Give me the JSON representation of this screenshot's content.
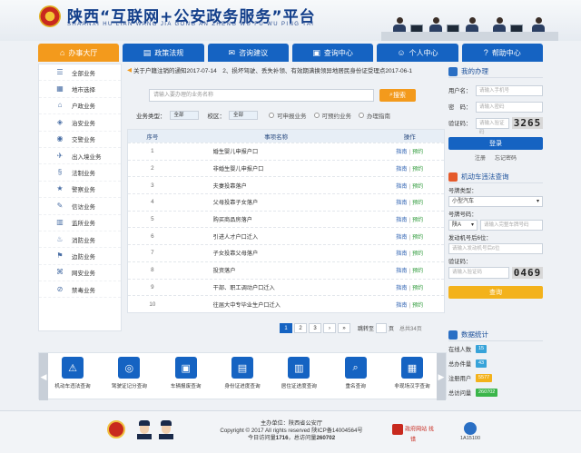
{
  "header": {
    "title": "陕西“互联网+公安政务服务”平台",
    "pinyin": "SHAANXI HU LIAN WANG JIA GONG AN ZHENG WU FU WU PING TAI"
  },
  "nav": [
    {
      "label": "办事大厅",
      "icon": "home-icon",
      "active": true
    },
    {
      "label": "政策法规",
      "icon": "book-icon",
      "active": false
    },
    {
      "label": "咨询建议",
      "icon": "chat-icon",
      "active": false
    },
    {
      "label": "查询中心",
      "icon": "search-monitor-icon",
      "active": false
    },
    {
      "label": "个人中心",
      "icon": "user-icon",
      "active": false
    },
    {
      "label": "帮助中心",
      "icon": "help-icon",
      "active": false
    }
  ],
  "sidebar": [
    {
      "label": "全部业务",
      "icon": "list-icon"
    },
    {
      "label": "地市选择",
      "icon": "city-icon"
    },
    {
      "label": "户政业务",
      "icon": "household-icon"
    },
    {
      "label": "治安业务",
      "icon": "security-icon"
    },
    {
      "label": "交警业务",
      "icon": "traffic-icon"
    },
    {
      "label": "出入境业务",
      "icon": "passport-icon"
    },
    {
      "label": "法制业务",
      "icon": "law-icon"
    },
    {
      "label": "警察业务",
      "icon": "police-icon"
    },
    {
      "label": "信访业务",
      "icon": "petition-icon"
    },
    {
      "label": "监所业务",
      "icon": "prison-icon"
    },
    {
      "label": "消防业务",
      "icon": "fire-icon"
    },
    {
      "label": "边防业务",
      "icon": "border-icon"
    },
    {
      "label": "网安业务",
      "icon": "network-icon"
    },
    {
      "label": "禁毒业务",
      "icon": "drug-icon"
    }
  ],
  "notice": "关于户籍注销的通知2017-07-14　2、损坏驾驶、丢失补领、有效期满换领异地居民身份证受理点2017-06-1",
  "search": {
    "placeholder": "请输入要办理的业务名称",
    "button": "搜索"
  },
  "filters": {
    "type_label": "业务类型：",
    "type_value": "全部",
    "area_label": "校区：",
    "area_value": "全部",
    "radios": [
      "可申报业务",
      "可预约业务",
      "办理指南"
    ]
  },
  "table": {
    "headers": [
      "序号",
      "事项名称",
      "操作"
    ],
    "rows": [
      {
        "no": "1",
        "name": "婚生婴儿申报户口",
        "guide": "指南",
        "book": "预约"
      },
      {
        "no": "2",
        "name": "非婚生婴儿申报户口",
        "guide": "指南",
        "book": "预约"
      },
      {
        "no": "3",
        "name": "夫妻投靠落户",
        "guide": "指南",
        "book": "预约"
      },
      {
        "no": "4",
        "name": "父母投靠子女落户",
        "guide": "指南",
        "book": "预约"
      },
      {
        "no": "5",
        "name": "购买商品房落户",
        "guide": "指南",
        "book": "预约"
      },
      {
        "no": "6",
        "name": "引进人才户口迁入",
        "guide": "指南",
        "book": "预约"
      },
      {
        "no": "7",
        "name": "子女投靠父母落户",
        "guide": "指南",
        "book": "预约"
      },
      {
        "no": "8",
        "name": "投资落户",
        "guide": "指南",
        "book": "预约"
      },
      {
        "no": "9",
        "name": "干部、职工调动户口迁入",
        "guide": "指南",
        "book": "预约"
      },
      {
        "no": "10",
        "name": "往届大中专毕业生户口迁入",
        "guide": "指南",
        "book": "预约"
      }
    ],
    "sep": "|"
  },
  "pager": {
    "pages": [
      "1",
      "2",
      "3"
    ],
    "next": "›",
    "last": "»",
    "jump_label": "跳转至",
    "page_unit": "页",
    "total": "总共34页"
  },
  "login": {
    "title": "我的办理",
    "user_label": "用户名：",
    "user_placeholder": "请输入手机号",
    "pwd_label": "密　码：",
    "pwd_placeholder": "请输入密码",
    "code_label": "验证码：",
    "code_placeholder": "请输入验证码",
    "code_value": "3265",
    "button": "登录",
    "register": "注册",
    "forgot": "忘记密码"
  },
  "vehicle": {
    "title": "机动车违法查询",
    "type_label": "号牌类型：",
    "type_value": "小型汽车",
    "plate_label": "号牌号码：",
    "plate_prefix": "陕A",
    "plate_placeholder": "请输入完整车牌号码",
    "engine_label": "发动机号后6位：",
    "engine_placeholder": "请输入发动机号后6位",
    "code_label": "验证码：",
    "code_placeholder": "请输入验证码",
    "code_value": "0469",
    "button": "查询"
  },
  "stats": {
    "title": "数据统计",
    "rows": [
      {
        "label": "在线人数",
        "value": "15",
        "color": "#37a3d9"
      },
      {
        "label": "总办件量",
        "value": "43",
        "color": "#37a3d9"
      },
      {
        "label": "注册用户",
        "value": "5577",
        "color": "#f3b21b"
      },
      {
        "label": "总访问量",
        "value": "260702",
        "color": "#3ab54a"
      }
    ]
  },
  "services": [
    {
      "label": "机动车违法查询",
      "icon": "car-query-icon"
    },
    {
      "label": "驾驶证记分查询",
      "icon": "license-score-icon"
    },
    {
      "label": "车辆报废查询",
      "icon": "car-scrap-icon"
    },
    {
      "label": "身份证进度查询",
      "icon": "id-card-icon"
    },
    {
      "label": "居住证进度查询",
      "icon": "residence-card-icon"
    },
    {
      "label": "重名查询",
      "icon": "name-search-icon"
    },
    {
      "label": "非现场汉字查询",
      "icon": "document-search-icon"
    }
  ],
  "footer": {
    "line1": "主办单位：陕西省公安厅",
    "line2": "Copyright © 2017 All rights reserved 陕ICP备14004564号",
    "line3_prefix": "今日访问量",
    "today": "1716",
    "line3_mid": "，总访问量",
    "total": "260702",
    "logo_text": "政府网站 找错",
    "logo2_text": "1A15100"
  }
}
